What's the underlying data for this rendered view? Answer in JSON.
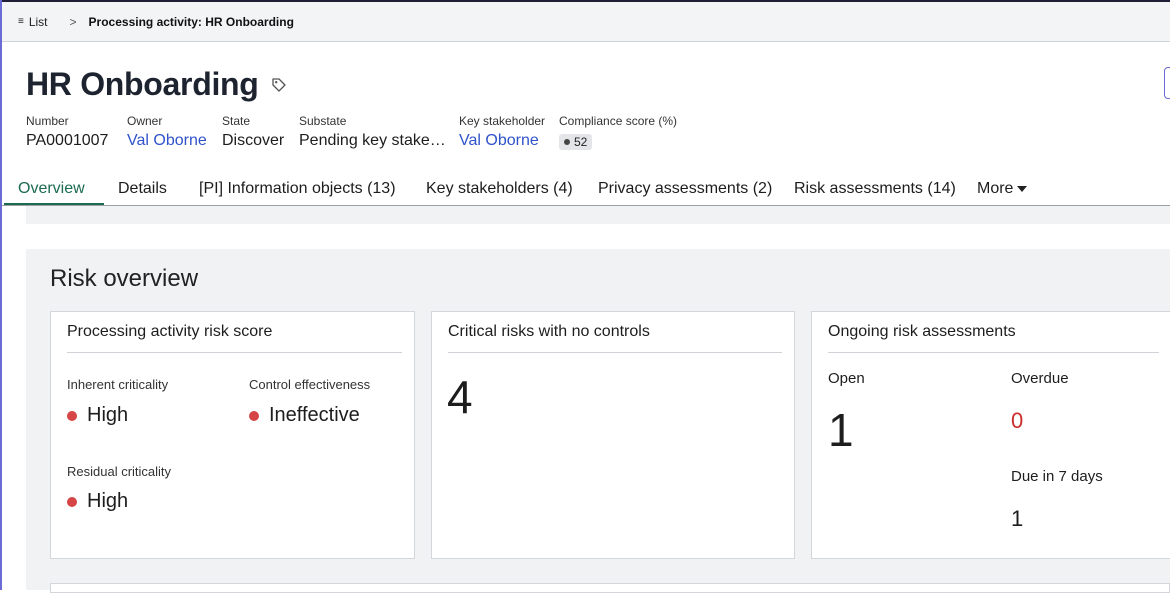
{
  "breadcrumb": {
    "list_label": "List",
    "current": "Processing activity: HR Onboarding"
  },
  "record": {
    "title": "HR Onboarding",
    "fields": {
      "number": {
        "label": "Number",
        "value": "PA0001007"
      },
      "owner": {
        "label": "Owner",
        "value": "Val Oborne"
      },
      "state": {
        "label": "State",
        "value": "Discover"
      },
      "substate": {
        "label": "Substate",
        "value": "Pending key stake…"
      },
      "key_stakeholder": {
        "label": "Key stakeholder",
        "value": "Val Oborne"
      },
      "compliance_score": {
        "label": "Compliance score (%)",
        "value": "52"
      }
    }
  },
  "tabs": [
    {
      "label": "Overview",
      "active": true
    },
    {
      "label": "Details"
    },
    {
      "label": "[PI] Information objects (13)"
    },
    {
      "label": "Key stakeholders (4)"
    },
    {
      "label": "Privacy assessments (2)"
    },
    {
      "label": "Risk assessments (14)"
    },
    {
      "label": "More"
    }
  ],
  "risk_overview": {
    "title": "Risk overview",
    "risk_score_card": {
      "title": "Processing activity risk score",
      "inherent_label": "Inherent criticality",
      "inherent_value": "High",
      "control_label": "Control effectiveness",
      "control_value": "Ineffective",
      "residual_label": "Residual criticality",
      "residual_value": "High"
    },
    "critical_card": {
      "title": "Critical risks with no controls",
      "value": "4"
    },
    "ongoing_card": {
      "title": "Ongoing risk assessments",
      "open_label": "Open",
      "open_value": "1",
      "overdue_label": "Overdue",
      "overdue_value": "0",
      "due_label": "Due in 7 days",
      "due_value": "1"
    }
  },
  "colors": {
    "accent_green": "#1c6b4f",
    "link_blue": "#2f53c9",
    "status_red": "#d64545",
    "overdue_red": "#c9302c"
  },
  "icons": [
    "menu-lines-icon",
    "chevron-right-icon",
    "tag-icon",
    "caret-down-icon"
  ]
}
